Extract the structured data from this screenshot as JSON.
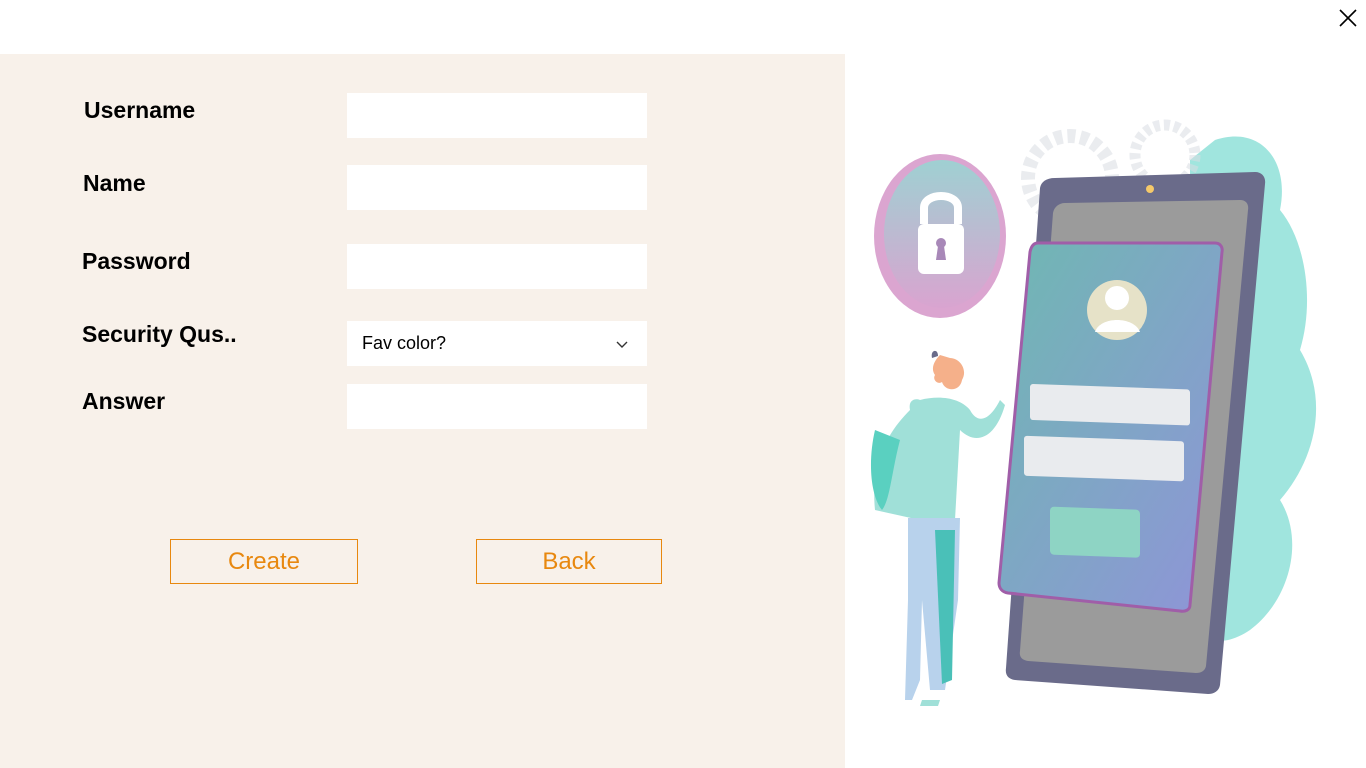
{
  "window": {
    "close_icon": "close-icon"
  },
  "form": {
    "username": {
      "label": "Username",
      "value": ""
    },
    "name": {
      "label": "Name",
      "value": ""
    },
    "password": {
      "label": "Password",
      "value": ""
    },
    "security_question": {
      "label": "Security Qus..",
      "selected": "Fav color?"
    },
    "answer": {
      "label": "Answer",
      "value": ""
    }
  },
  "buttons": {
    "create_label": "Create",
    "back_label": "Back"
  },
  "colors": {
    "panel_bg": "#f8f1ea",
    "accent": "#e8880f"
  },
  "illustration": {
    "description_icon": "phone-login-illustration"
  }
}
